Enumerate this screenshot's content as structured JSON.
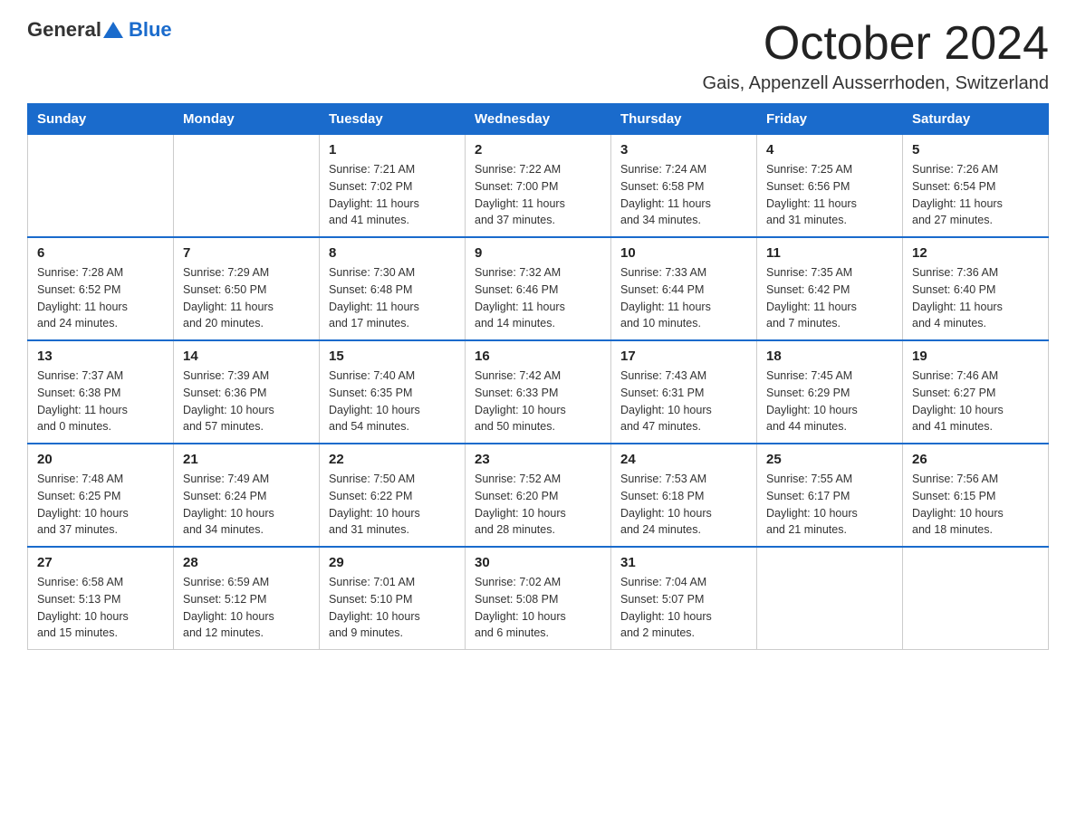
{
  "logo": {
    "general": "General",
    "blue": "Blue"
  },
  "title": "October 2024",
  "location": "Gais, Appenzell Ausserrhoden, Switzerland",
  "headers": [
    "Sunday",
    "Monday",
    "Tuesday",
    "Wednesday",
    "Thursday",
    "Friday",
    "Saturday"
  ],
  "weeks": [
    [
      {
        "day": "",
        "info": ""
      },
      {
        "day": "",
        "info": ""
      },
      {
        "day": "1",
        "info": "Sunrise: 7:21 AM\nSunset: 7:02 PM\nDaylight: 11 hours\nand 41 minutes."
      },
      {
        "day": "2",
        "info": "Sunrise: 7:22 AM\nSunset: 7:00 PM\nDaylight: 11 hours\nand 37 minutes."
      },
      {
        "day": "3",
        "info": "Sunrise: 7:24 AM\nSunset: 6:58 PM\nDaylight: 11 hours\nand 34 minutes."
      },
      {
        "day": "4",
        "info": "Sunrise: 7:25 AM\nSunset: 6:56 PM\nDaylight: 11 hours\nand 31 minutes."
      },
      {
        "day": "5",
        "info": "Sunrise: 7:26 AM\nSunset: 6:54 PM\nDaylight: 11 hours\nand 27 minutes."
      }
    ],
    [
      {
        "day": "6",
        "info": "Sunrise: 7:28 AM\nSunset: 6:52 PM\nDaylight: 11 hours\nand 24 minutes."
      },
      {
        "day": "7",
        "info": "Sunrise: 7:29 AM\nSunset: 6:50 PM\nDaylight: 11 hours\nand 20 minutes."
      },
      {
        "day": "8",
        "info": "Sunrise: 7:30 AM\nSunset: 6:48 PM\nDaylight: 11 hours\nand 17 minutes."
      },
      {
        "day": "9",
        "info": "Sunrise: 7:32 AM\nSunset: 6:46 PM\nDaylight: 11 hours\nand 14 minutes."
      },
      {
        "day": "10",
        "info": "Sunrise: 7:33 AM\nSunset: 6:44 PM\nDaylight: 11 hours\nand 10 minutes."
      },
      {
        "day": "11",
        "info": "Sunrise: 7:35 AM\nSunset: 6:42 PM\nDaylight: 11 hours\nand 7 minutes."
      },
      {
        "day": "12",
        "info": "Sunrise: 7:36 AM\nSunset: 6:40 PM\nDaylight: 11 hours\nand 4 minutes."
      }
    ],
    [
      {
        "day": "13",
        "info": "Sunrise: 7:37 AM\nSunset: 6:38 PM\nDaylight: 11 hours\nand 0 minutes."
      },
      {
        "day": "14",
        "info": "Sunrise: 7:39 AM\nSunset: 6:36 PM\nDaylight: 10 hours\nand 57 minutes."
      },
      {
        "day": "15",
        "info": "Sunrise: 7:40 AM\nSunset: 6:35 PM\nDaylight: 10 hours\nand 54 minutes."
      },
      {
        "day": "16",
        "info": "Sunrise: 7:42 AM\nSunset: 6:33 PM\nDaylight: 10 hours\nand 50 minutes."
      },
      {
        "day": "17",
        "info": "Sunrise: 7:43 AM\nSunset: 6:31 PM\nDaylight: 10 hours\nand 47 minutes."
      },
      {
        "day": "18",
        "info": "Sunrise: 7:45 AM\nSunset: 6:29 PM\nDaylight: 10 hours\nand 44 minutes."
      },
      {
        "day": "19",
        "info": "Sunrise: 7:46 AM\nSunset: 6:27 PM\nDaylight: 10 hours\nand 41 minutes."
      }
    ],
    [
      {
        "day": "20",
        "info": "Sunrise: 7:48 AM\nSunset: 6:25 PM\nDaylight: 10 hours\nand 37 minutes."
      },
      {
        "day": "21",
        "info": "Sunrise: 7:49 AM\nSunset: 6:24 PM\nDaylight: 10 hours\nand 34 minutes."
      },
      {
        "day": "22",
        "info": "Sunrise: 7:50 AM\nSunset: 6:22 PM\nDaylight: 10 hours\nand 31 minutes."
      },
      {
        "day": "23",
        "info": "Sunrise: 7:52 AM\nSunset: 6:20 PM\nDaylight: 10 hours\nand 28 minutes."
      },
      {
        "day": "24",
        "info": "Sunrise: 7:53 AM\nSunset: 6:18 PM\nDaylight: 10 hours\nand 24 minutes."
      },
      {
        "day": "25",
        "info": "Sunrise: 7:55 AM\nSunset: 6:17 PM\nDaylight: 10 hours\nand 21 minutes."
      },
      {
        "day": "26",
        "info": "Sunrise: 7:56 AM\nSunset: 6:15 PM\nDaylight: 10 hours\nand 18 minutes."
      }
    ],
    [
      {
        "day": "27",
        "info": "Sunrise: 6:58 AM\nSunset: 5:13 PM\nDaylight: 10 hours\nand 15 minutes."
      },
      {
        "day": "28",
        "info": "Sunrise: 6:59 AM\nSunset: 5:12 PM\nDaylight: 10 hours\nand 12 minutes."
      },
      {
        "day": "29",
        "info": "Sunrise: 7:01 AM\nSunset: 5:10 PM\nDaylight: 10 hours\nand 9 minutes."
      },
      {
        "day": "30",
        "info": "Sunrise: 7:02 AM\nSunset: 5:08 PM\nDaylight: 10 hours\nand 6 minutes."
      },
      {
        "day": "31",
        "info": "Sunrise: 7:04 AM\nSunset: 5:07 PM\nDaylight: 10 hours\nand 2 minutes."
      },
      {
        "day": "",
        "info": ""
      },
      {
        "day": "",
        "info": ""
      }
    ]
  ]
}
